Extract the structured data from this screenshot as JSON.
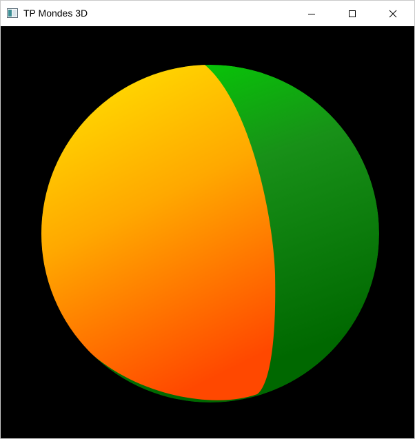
{
  "window": {
    "title": "TP Mondes 3D",
    "icons": {
      "app": "application-window-icon",
      "minimize": "minimize-icon",
      "maximize": "maximize-icon",
      "close": "close-icon"
    }
  },
  "scene": {
    "background_color": "#000000",
    "sphere": {
      "left_region_colors": [
        "#ffe000",
        "#ffa800",
        "#ff4800"
      ],
      "right_region_colors": [
        "#00dd00",
        "#189018",
        "#006800"
      ]
    }
  }
}
